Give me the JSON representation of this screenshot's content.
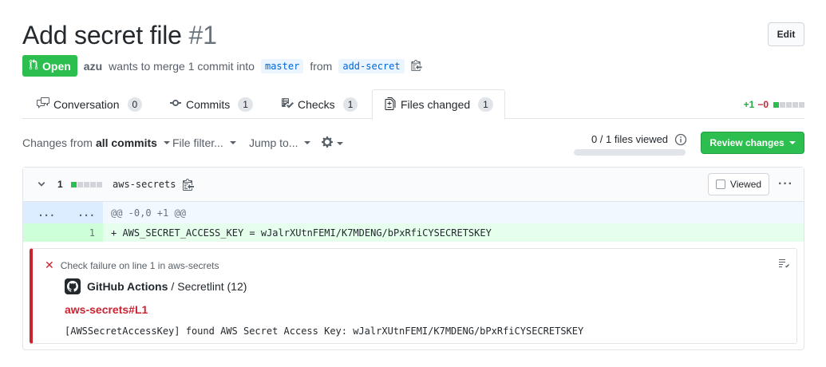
{
  "header": {
    "title": "Add secret file",
    "number": "#1",
    "edit_label": "Edit"
  },
  "meta": {
    "state": "Open",
    "author": "azu",
    "action_text": "wants to merge 1 commit into",
    "base_branch": "master",
    "from_text": "from",
    "head_branch": "add-secret"
  },
  "tabs": [
    {
      "label": "Conversation",
      "count": "0",
      "icon": "comment-discussion-icon"
    },
    {
      "label": "Commits",
      "count": "1",
      "icon": "git-commit-icon"
    },
    {
      "label": "Checks",
      "count": "1",
      "icon": "checklist-icon"
    },
    {
      "label": "Files changed",
      "count": "1",
      "icon": "file-diff-icon",
      "active": true
    }
  ],
  "diffstat": {
    "additions": "+1",
    "deletions": "−0"
  },
  "toolbar": {
    "changes_from_prefix": "Changes from",
    "changes_from_value": "all commits",
    "file_filter": "File filter...",
    "jump_to": "Jump to...",
    "files_viewed": "0 / 1 files viewed",
    "files_viewed_fraction": 0,
    "review_button": "Review changes"
  },
  "file": {
    "changes": "1",
    "name": "aws-secrets",
    "viewed_label": "Viewed",
    "hunk_left": "...",
    "hunk_right": "...",
    "hunk_header": "@@ -0,0 +1 @@",
    "line_number": "1",
    "added_line": "+ AWS_SECRET_ACCESS_KEY = wJalrXUtnFEMI/K7MDENG/bPxRfiCYSECRETSKEY"
  },
  "annotation": {
    "title": "Check failure on line 1 in aws-secrets",
    "app_name": "GitHub Actions",
    "separator": "/",
    "check_name": "Secretlint (12)",
    "link": "aws-secrets#L1",
    "message": "[AWSSecretAccessKey] found AWS Secret Access Key: wJalrXUtnFEMI/K7MDENG/bPxRfiCYSECRETSKEY"
  },
  "colors": {
    "accent_green": "#2cbe4e",
    "failure_red": "#cb2431",
    "link_blue": "#0366d6"
  }
}
